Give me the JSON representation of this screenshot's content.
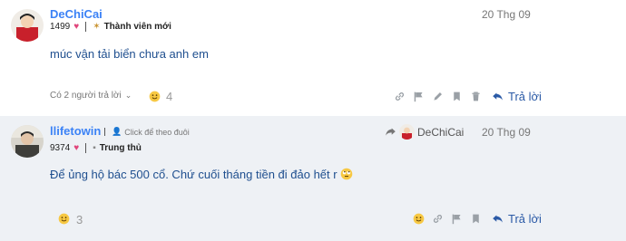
{
  "posts": [
    {
      "username": "DeChiCai",
      "likes_count": "1499",
      "badge": "Thành viên mới",
      "date": "20 Thg 09",
      "text": "múc vận tải biển chưa anh em",
      "replies_toggle": "Có 2 người trả lời",
      "reaction_count": "4",
      "reply_label": "Trả lời"
    },
    {
      "username": "llifetowin",
      "follow_hint": "Click để theo đuôi",
      "likes_count": "9374",
      "badge": "Trung thủ",
      "reply_to_user": "DeChiCai",
      "date": "20 Thg 09",
      "text": "Để ủng hộ bác 500 cổ. Chứ cuối tháng tiền đi đảo hết r",
      "reaction_count": "3",
      "reply_label": "Trả lời"
    }
  ],
  "colors": {
    "accent": "#3b82f6",
    "reply_text": "#2b5aa6",
    "heart": "#e0457b",
    "highlight_bg": "#eef1f5"
  }
}
